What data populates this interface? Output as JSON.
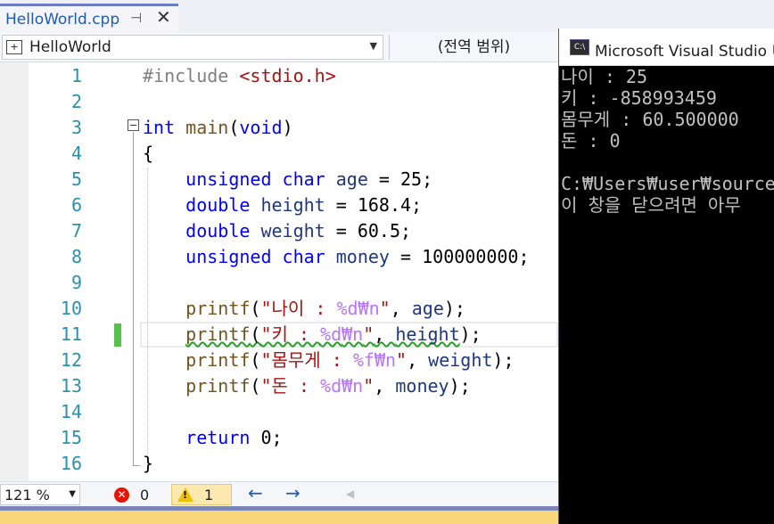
{
  "tab": {
    "label": "HelloWorld.cpp",
    "pin_glyph": "⊣",
    "close_glyph": "✕"
  },
  "navbar": {
    "project": "HelloWorld",
    "scope": "(전역 범위)"
  },
  "code_lines": [
    {
      "n": "1",
      "segments": [
        [
          "pp",
          "#include "
        ],
        [
          "str",
          "<stdio.h>"
        ]
      ]
    },
    {
      "n": "2",
      "segments": []
    },
    {
      "n": "3",
      "segments": [
        [
          "kw",
          "int"
        ],
        [
          "plain",
          " "
        ],
        [
          "fn",
          "main"
        ],
        [
          "plain",
          "("
        ],
        [
          "kw",
          "void"
        ],
        [
          "plain",
          ")"
        ]
      ]
    },
    {
      "n": "4",
      "segments": [
        [
          "plain",
          "{"
        ]
      ]
    },
    {
      "n": "5",
      "segments": [
        [
          "plain",
          "    "
        ],
        [
          "kw",
          "unsigned char"
        ],
        [
          "plain",
          " "
        ],
        [
          "var",
          "age"
        ],
        [
          "plain",
          " = 25;"
        ]
      ]
    },
    {
      "n": "6",
      "segments": [
        [
          "plain",
          "    "
        ],
        [
          "kw",
          "double"
        ],
        [
          "plain",
          " "
        ],
        [
          "var",
          "height"
        ],
        [
          "plain",
          " = 168.4;"
        ]
      ]
    },
    {
      "n": "7",
      "segments": [
        [
          "plain",
          "    "
        ],
        [
          "kw",
          "double"
        ],
        [
          "plain",
          " "
        ],
        [
          "var",
          "weight"
        ],
        [
          "plain",
          " = 60.5;"
        ]
      ]
    },
    {
      "n": "8",
      "segments": [
        [
          "plain",
          "    "
        ],
        [
          "kw",
          "unsigned char"
        ],
        [
          "plain",
          " "
        ],
        [
          "var",
          "money"
        ],
        [
          "plain",
          " = 100000000;"
        ]
      ]
    },
    {
      "n": "9",
      "segments": []
    },
    {
      "n": "10",
      "segments": [
        [
          "plain",
          "    "
        ],
        [
          "fn",
          "printf"
        ],
        [
          "plain",
          "("
        ],
        [
          "str",
          "\"나이 : "
        ],
        [
          "fmt",
          "%d"
        ],
        [
          "esc",
          "₩n"
        ],
        [
          "str",
          "\""
        ],
        [
          "plain",
          ", "
        ],
        [
          "var",
          "age"
        ],
        [
          "plain",
          ");"
        ]
      ]
    },
    {
      "n": "11",
      "segments": [
        [
          "plain",
          "    "
        ],
        [
          "fnsq",
          "printf"
        ],
        [
          "plainsq",
          "("
        ],
        [
          "strsq",
          "\"키 : "
        ],
        [
          "fmtsq",
          "%d"
        ],
        [
          "escsq",
          "₩n"
        ],
        [
          "strsq",
          "\""
        ],
        [
          "plainsq",
          ", "
        ],
        [
          "varsq",
          "height"
        ],
        [
          "plain",
          ");"
        ]
      ]
    },
    {
      "n": "12",
      "segments": [
        [
          "plain",
          "    "
        ],
        [
          "fn",
          "printf"
        ],
        [
          "plain",
          "("
        ],
        [
          "str",
          "\"몸무게 : "
        ],
        [
          "fmt",
          "%f"
        ],
        [
          "esc",
          "₩n"
        ],
        [
          "str",
          "\""
        ],
        [
          "plain",
          ", "
        ],
        [
          "var",
          "weight"
        ],
        [
          "plain",
          ");"
        ]
      ]
    },
    {
      "n": "13",
      "segments": [
        [
          "plain",
          "    "
        ],
        [
          "fn",
          "printf"
        ],
        [
          "plain",
          "("
        ],
        [
          "str",
          "\"돈 : "
        ],
        [
          "fmt",
          "%d"
        ],
        [
          "esc",
          "₩n"
        ],
        [
          "str",
          "\""
        ],
        [
          "plain",
          ", "
        ],
        [
          "var",
          "money"
        ],
        [
          "plain",
          ");"
        ]
      ]
    },
    {
      "n": "14",
      "segments": []
    },
    {
      "n": "15",
      "segments": [
        [
          "plain",
          "    "
        ],
        [
          "kw",
          "return"
        ],
        [
          "plain",
          " 0;"
        ]
      ]
    },
    {
      "n": "16",
      "segments": [
        [
          "plain",
          "}"
        ]
      ]
    }
  ],
  "statusbar": {
    "zoom": "121 %",
    "errors": "0",
    "warnings": "1",
    "back_glyph": "←",
    "forward_glyph": "→",
    "scroll_left_glyph": "◀"
  },
  "console": {
    "title": "Microsoft Visual Studio 디",
    "icon_text": "C:\\",
    "lines": [
      "나이 : 25",
      "키 : -858993459",
      "몸무게 : 60.500000",
      "돈 : 0",
      "",
      "C:₩Users₩user₩source₩",
      "이 창을 닫으려면 아무"
    ]
  },
  "colors": {
    "keyword": "#0000ff",
    "string": "#a31515",
    "line_number": "#2b91af",
    "console_bg": "#000000",
    "console_text": "#c0c0c0",
    "change_marker": "#57c14e",
    "warning_badge": "#fde9b0"
  }
}
